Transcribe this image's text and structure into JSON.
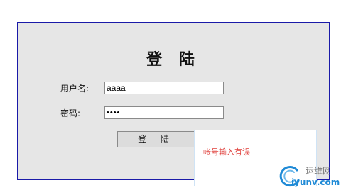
{
  "login": {
    "title": "登 陆",
    "username_label": "用户名:",
    "username_value": "aaaa",
    "password_label": "密码:",
    "password_value": "••••",
    "submit_label": "登 陆"
  },
  "error": {
    "message": "帐号输入有误"
  },
  "watermark": {
    "name": "运维网",
    "url": "iyunv.com"
  },
  "colors": {
    "panel_border": "#1a1aa8",
    "panel_bg": "#e6e6e6",
    "error_text": "#e0403c",
    "watermark_blue": "#1f8ad6"
  }
}
